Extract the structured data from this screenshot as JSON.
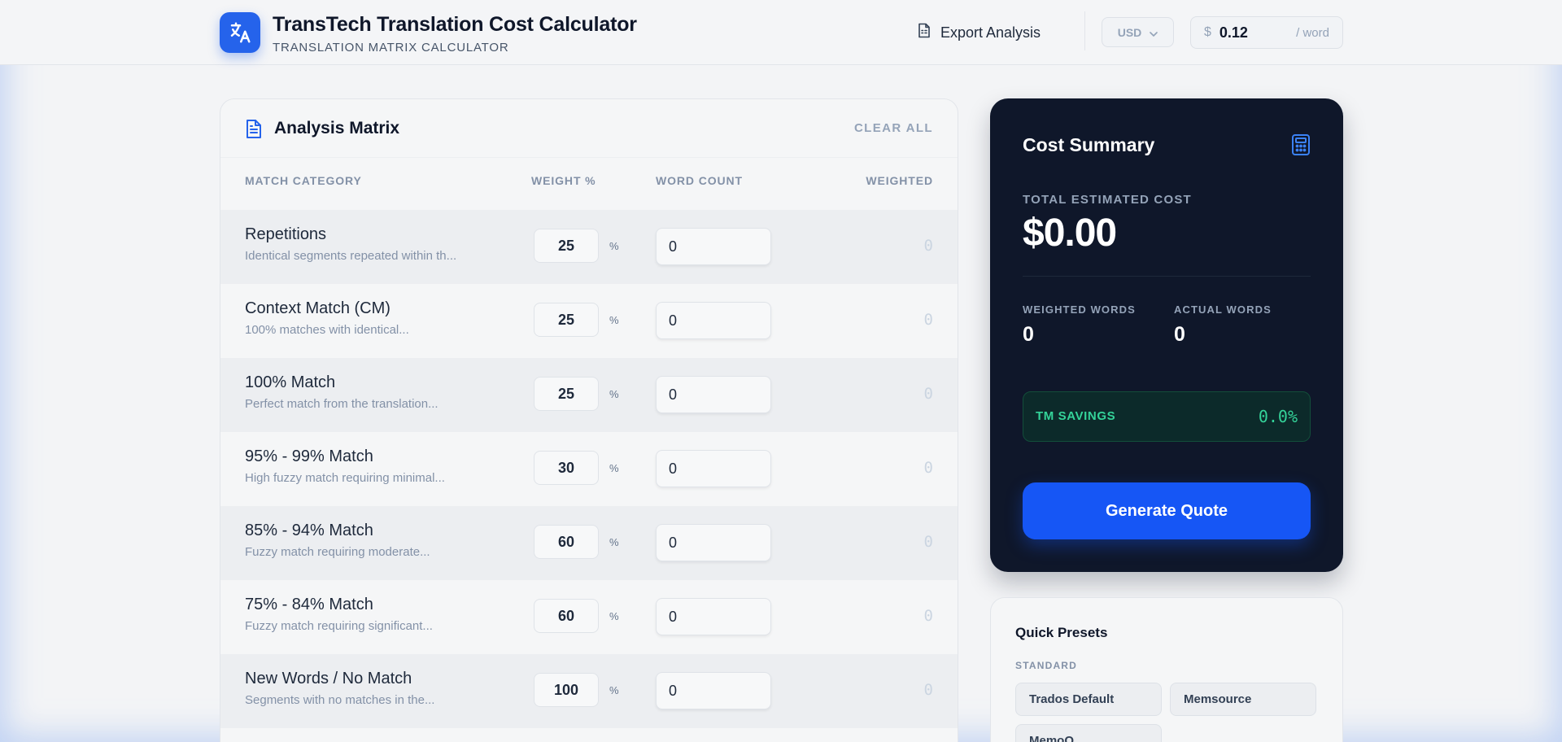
{
  "header": {
    "title": "TransTech Translation Cost Calculator",
    "subtitle": "TRANSLATION MATRIX CALCULATOR",
    "export_label": "Export Analysis",
    "currency": "USD",
    "rate_symbol": "$",
    "rate_value": "0.12",
    "rate_unit": "/ word"
  },
  "matrix": {
    "title": "Analysis Matrix",
    "clear_label": "CLEAR ALL",
    "columns": [
      "MATCH CATEGORY",
      "WEIGHT %",
      "WORD COUNT",
      "WEIGHTED"
    ],
    "percent_symbol": "%",
    "rows": [
      {
        "name": "Repetitions",
        "desc": "Identical segments repeated within th...",
        "weight": "25",
        "count": "0",
        "weighted": "0"
      },
      {
        "name": "Context Match (CM)",
        "desc": "100% matches with identical...",
        "weight": "25",
        "count": "0",
        "weighted": "0"
      },
      {
        "name": "100% Match",
        "desc": "Perfect match from the translation...",
        "weight": "25",
        "count": "0",
        "weighted": "0"
      },
      {
        "name": "95% - 99% Match",
        "desc": "High fuzzy match requiring minimal...",
        "weight": "30",
        "count": "0",
        "weighted": "0"
      },
      {
        "name": "85% - 94% Match",
        "desc": "Fuzzy match requiring moderate...",
        "weight": "60",
        "count": "0",
        "weighted": "0"
      },
      {
        "name": "75% - 84% Match",
        "desc": "Fuzzy match requiring significant...",
        "weight": "60",
        "count": "0",
        "weighted": "0"
      },
      {
        "name": "New Words / No Match",
        "desc": "Segments with no matches in the...",
        "weight": "100",
        "count": "0",
        "weighted": "0"
      }
    ]
  },
  "summary": {
    "title": "Cost Summary",
    "total_label": "TOTAL ESTIMATED COST",
    "total_value": "$0.00",
    "weighted_label": "WEIGHTED WORDS",
    "weighted_value": "0",
    "actual_label": "ACTUAL WORDS",
    "actual_value": "0",
    "savings_label": "TM SAVINGS",
    "savings_value": "0.0%",
    "quote_label": "Generate Quote"
  },
  "presets": {
    "title": "Quick Presets",
    "group_label": "STANDARD",
    "items": [
      "Trados Default",
      "Memsource",
      "MemoQ"
    ]
  },
  "colors": {
    "accent": "#1656f5",
    "summary_bg": "#0f172a",
    "savings_green": "#34d399"
  },
  "icons": {
    "logo": "translate-icon",
    "export": "document-icon",
    "currency": "chevron-down-icon",
    "matrix": "document-icon",
    "summary": "calculator-icon"
  }
}
